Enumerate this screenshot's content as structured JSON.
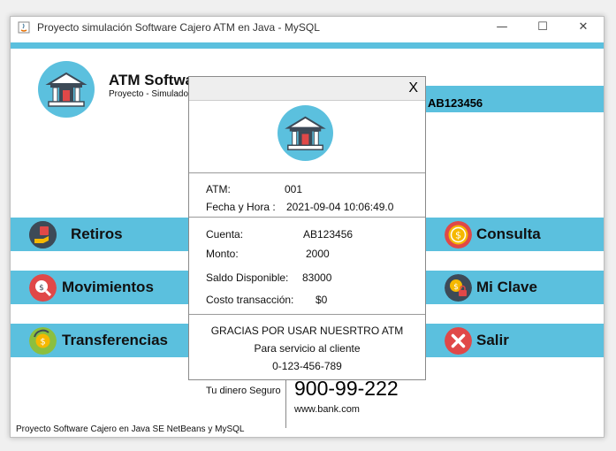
{
  "window": {
    "title": "Proyecto simulación Software Cajero ATM en Java - MySQL",
    "minimize": "—",
    "maximize": "☐",
    "close": "✕"
  },
  "header": {
    "app_name": "ATM Software",
    "subtitle": "Proyecto - Simulador",
    "account_number": "AB123456"
  },
  "menu": {
    "retiros": "Retiros",
    "movimientos": "Movimientos",
    "transferencias": "Transferencias",
    "consulta": "Consulta",
    "mi_clave": "Mi Clave",
    "salir": "Salir"
  },
  "footer": {
    "project_text": "Proyecto Software Cajero en Java SE NetBeans y MySQL",
    "tagline": "Tu dinero Seguro",
    "phone": "900-99-222",
    "website": "www.bank.com"
  },
  "receipt": {
    "close_label": "X",
    "atm_label": "ATM:",
    "atm_value": "001",
    "date_label": "Fecha y Hora :",
    "date_value": "2021-09-04 10:06:49.0",
    "cuenta_label": "Cuenta:",
    "cuenta_value": "AB123456",
    "monto_label": "Monto:",
    "monto_value": "2000",
    "saldo_label": "Saldo Disponible:",
    "saldo_value": "83000",
    "costo_label": "Costo transacción:",
    "costo_value": "$0",
    "thanks": "GRACIAS POR USAR NUESRTRO ATM",
    "service": "Para servicio al cliente",
    "service_phone": "0-123-456-789"
  },
  "colors": {
    "accent": "#5bc0de",
    "dark_icon": "#3d4a57",
    "gold": "#f5b800",
    "red": "#e04848"
  },
  "icons": {
    "logo": "bank-icon",
    "retiros": "cash-hand-icon",
    "movimientos": "money-search-icon",
    "transferencias": "money-exchange-icon",
    "consulta": "coin-icon",
    "mi_clave": "money-lock-icon",
    "salir": "close-circle-icon"
  }
}
